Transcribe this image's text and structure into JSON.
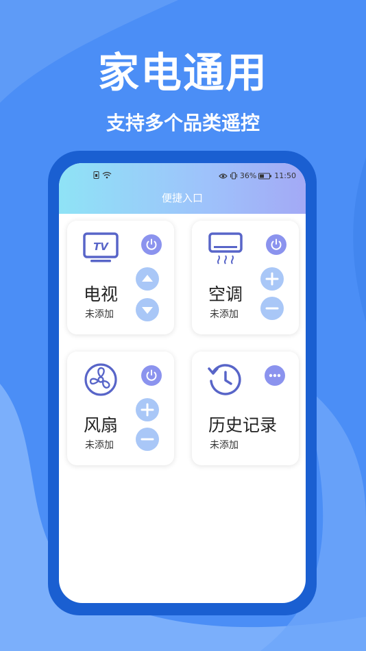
{
  "hero": {
    "title": "家电通用",
    "subtitle": "支持多个品类遥控"
  },
  "status_bar": {
    "left_icons": [
      "sim-icon",
      "wifi-icon"
    ],
    "battery_text": "36%",
    "time": "11:50"
  },
  "screen": {
    "title": "便捷入口"
  },
  "cards": [
    {
      "name": "电视",
      "status": "未添加",
      "icon": "tv-icon",
      "controls": [
        "power-icon",
        "channel-up-icon",
        "channel-down-icon"
      ]
    },
    {
      "name": "空调",
      "status": "未添加",
      "icon": "air-conditioner-icon",
      "controls": [
        "power-icon",
        "plus-icon",
        "minus-icon"
      ]
    },
    {
      "name": "风扇",
      "status": "未添加",
      "icon": "fan-icon",
      "controls": [
        "power-icon",
        "plus-icon",
        "minus-icon"
      ]
    },
    {
      "name": "历史记录",
      "status": "未添加",
      "icon": "history-icon",
      "controls": [
        "more-icon"
      ]
    }
  ],
  "colors": {
    "background": "#4b8ef6",
    "phone_frame": "#1a5fd1",
    "icon_primary": "#5865c8",
    "button_purple": "#8b93ee",
    "button_light_blue": "#a9c7f7"
  }
}
